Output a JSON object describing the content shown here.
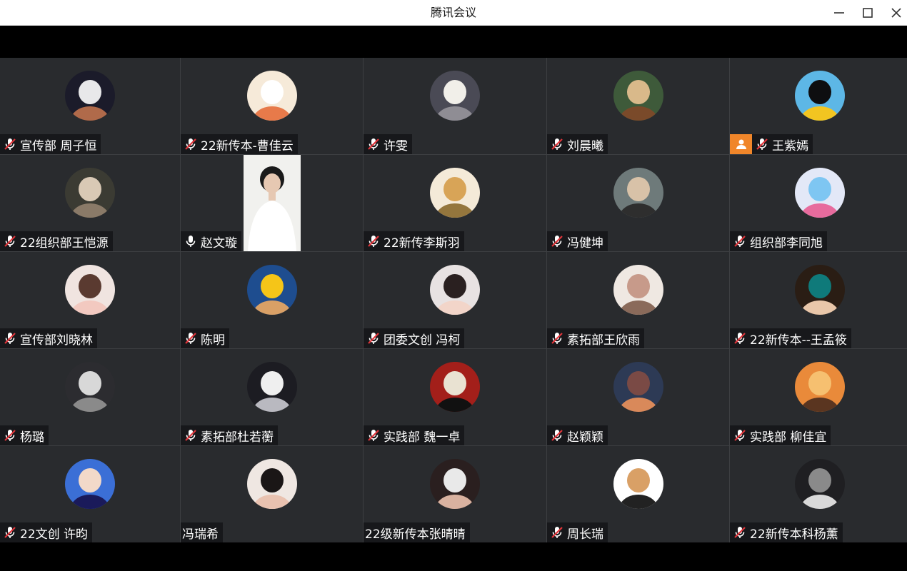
{
  "window": {
    "title": "腾讯会议"
  },
  "colors": {
    "host_badge": "#f0862a",
    "tile_bg": "#292b2e",
    "grid_line": "#3d3f42"
  },
  "participants": [
    {
      "name": "宣传部 周子恒",
      "mic": "muted",
      "display": "avatar",
      "colors": [
        "#1b1b2a",
        "#e8e8ea",
        "#b06a4a"
      ]
    },
    {
      "name": "22新传本-曹佳云",
      "mic": "muted",
      "display": "avatar",
      "colors": [
        "#f6ead9",
        "#ffffff",
        "#e77a4a"
      ]
    },
    {
      "name": "许雯",
      "mic": "muted",
      "display": "avatar",
      "colors": [
        "#4a4a55",
        "#f1efe9",
        "#8f8d94"
      ]
    },
    {
      "name": "刘晨曦",
      "mic": "muted",
      "display": "avatar",
      "colors": [
        "#3e5a3a",
        "#d9b98a",
        "#7a4a2a"
      ]
    },
    {
      "name": "王紫嫣",
      "mic": "muted",
      "display": "avatar",
      "host": true,
      "colors": [
        "#5db7e6",
        "#0e0e10",
        "#f2c521"
      ]
    },
    {
      "name": "22组织部王恺源",
      "mic": "muted",
      "display": "avatar",
      "colors": [
        "#3b3b33",
        "#d9c9b5",
        "#8a7a68"
      ]
    },
    {
      "name": "赵文璇",
      "mic": "on",
      "display": "video",
      "colors": [
        "#f1f1ee",
        "#e6c8b2",
        "#1a1a1a"
      ]
    },
    {
      "name": "22新传李斯羽",
      "mic": "muted",
      "display": "avatar",
      "colors": [
        "#f4ead8",
        "#d8a457",
        "#94763d"
      ]
    },
    {
      "name": "冯健坤",
      "mic": "muted",
      "display": "avatar",
      "colors": [
        "#6e7a7a",
        "#d8c2a8",
        "#2e2e2e"
      ]
    },
    {
      "name": "组织部李同旭",
      "mic": "muted",
      "display": "avatar",
      "colors": [
        "#e3e8f7",
        "#7ec6f2",
        "#e76b9d"
      ]
    },
    {
      "name": "宣传部刘晓林",
      "mic": "muted",
      "display": "avatar",
      "colors": [
        "#f0e4e0",
        "#5a3a30",
        "#f2c9c0"
      ]
    },
    {
      "name": "陈明",
      "mic": "muted",
      "display": "avatar",
      "colors": [
        "#1e4d8f",
        "#f5c518",
        "#d9a066"
      ]
    },
    {
      "name": "团委文创 冯柯",
      "mic": "muted",
      "display": "avatar",
      "colors": [
        "#e8e2e2",
        "#2a2020",
        "#f2d5c9"
      ]
    },
    {
      "name": "素拓部王欣雨",
      "mic": "muted",
      "display": "avatar",
      "colors": [
        "#efe8e2",
        "#c79a8a",
        "#8a6a5a"
      ]
    },
    {
      "name": "22新传本--王孟筱",
      "mic": "muted",
      "display": "avatar",
      "colors": [
        "#2a1d14",
        "#0f7a7a",
        "#e9c7aa"
      ]
    },
    {
      "name": "杨璐",
      "mic": "muted",
      "display": "avatar",
      "colors": [
        "#2c2c30",
        "#d8d8d8",
        "#8a8a8a"
      ]
    },
    {
      "name": "素拓部杜若蘅",
      "mic": "muted",
      "display": "avatar",
      "colors": [
        "#1c1c22",
        "#efefef",
        "#b9b9c0"
      ]
    },
    {
      "name": "实践部 魏一卓",
      "mic": "muted",
      "display": "avatar",
      "colors": [
        "#a31f1a",
        "#e9e2d2",
        "#111111"
      ]
    },
    {
      "name": "赵颖颖",
      "mic": "muted",
      "display": "avatar",
      "colors": [
        "#2d3a55",
        "#7a4a45",
        "#d9895a"
      ]
    },
    {
      "name": "实践部 柳佳宜",
      "mic": "muted",
      "display": "avatar",
      "colors": [
        "#e98a3a",
        "#f6c070",
        "#5a3520"
      ]
    },
    {
      "name": "22文创 许昀",
      "mic": "muted",
      "display": "avatar",
      "colors": [
        "#3b6fd6",
        "#f2d9c9",
        "#1a1a5a"
      ]
    },
    {
      "name": "冯瑞希",
      "mic": "none",
      "display": "avatar",
      "colors": [
        "#efe7e2",
        "#1a1616",
        "#e9c2b0"
      ]
    },
    {
      "name": "22级新传本张晴晴",
      "mic": "none",
      "display": "avatar",
      "colors": [
        "#2a1f1f",
        "#e9e9e9",
        "#d9b2a0"
      ]
    },
    {
      "name": "周长瑞",
      "mic": "muted",
      "display": "avatar",
      "colors": [
        "#ffffff",
        "#d9a066",
        "#222222"
      ]
    },
    {
      "name": "22新传本科杨薰",
      "mic": "muted",
      "display": "avatar",
      "colors": [
        "#1f1f22",
        "#8a8a8a",
        "#d9d9d9"
      ]
    }
  ]
}
